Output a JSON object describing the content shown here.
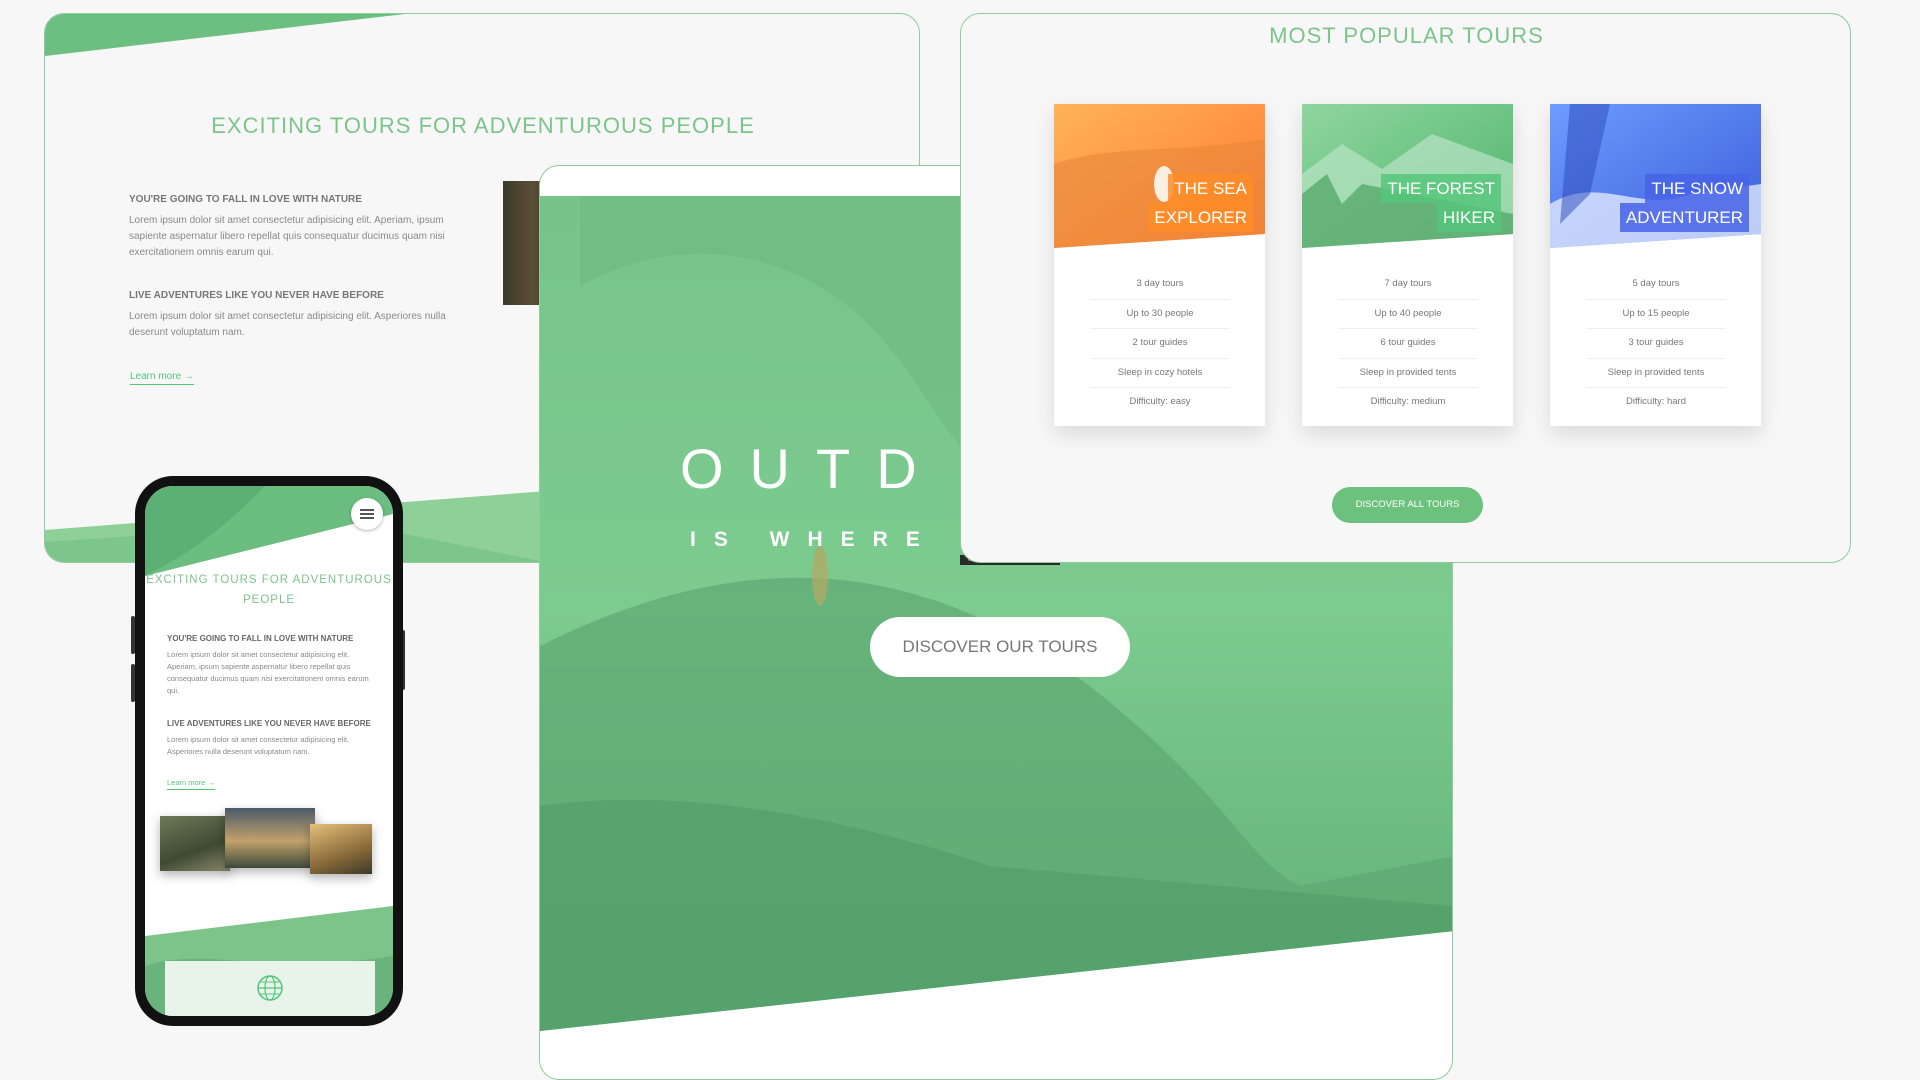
{
  "about": {
    "title": "EXCITING TOURS FOR ADVENTUROUS PEOPLE",
    "blocks": [
      {
        "heading": "YOU'RE GOING TO FALL IN LOVE WITH NATURE",
        "body": "Lorem ipsum dolor sit amet consectetur adipisicing elit. Aperiam, ipsum sapiente aspernatur libero repellat quis consequatur ducimus quam nisi exercitationem omnis earum qui."
      },
      {
        "heading": "LIVE ADVENTURES LIKE YOU NEVER HAVE BEFORE",
        "body": "Lorem ipsum dolor sit amet consectetur adipisicing elit. Asperiores nulla deserunt voluptatum nam."
      }
    ],
    "learn_more": "Learn more →"
  },
  "hero": {
    "heading": "OUTD",
    "subheading": "IS WHERE L",
    "cta": "DISCOVER OUR TOURS",
    "tooltip": "div.Lsfw. 596.4x84.4px"
  },
  "tours": {
    "title": "MOST POPULAR TOURS",
    "cta": "DISCOVER ALL TOURS",
    "cards": [
      {
        "name_line1": "THE SEA",
        "name_line2": "EXPLORER",
        "details": [
          "3 day tours",
          "Up to 30 people",
          "2 tour guides",
          "Sleep in cozy hotels",
          "Difficulty: easy"
        ]
      },
      {
        "name_line1": "THE FOREST",
        "name_line2": "HIKER",
        "details": [
          "7 day tours",
          "Up to 40 people",
          "6 tour guides",
          "Sleep in provided tents",
          "Difficulty: medium"
        ]
      },
      {
        "name_line1": "THE SNOW",
        "name_line2": "ADVENTURER",
        "details": [
          "5 day tours",
          "Up to 15 people",
          "3 tour guides",
          "Sleep in provided tents",
          "Difficulty: hard"
        ]
      }
    ]
  },
  "phone": {
    "title": "EXCITING TOURS FOR ADVENTUROUS PEOPLE",
    "blocks": [
      {
        "heading": "YOU'RE GOING TO FALL IN LOVE WITH NATURE",
        "body": "Lorem ipsum dolor sit amet consectetur adipisicing elit. Aperiam, ipsum sapiente aspernatur libero repellat quis consequatur ducimus quam nisi exercitationem omnis earum qui."
      },
      {
        "heading": "LIVE ADVENTURES LIKE YOU NEVER HAVE BEFORE",
        "body": "Lorem ipsum dolor sit amet consectetur adipisicing elit. Asperiores nulla deserunt voluptatum nam."
      }
    ],
    "learn_more": "Learn more →",
    "menu_icon": "hamburger-icon",
    "footer_icon": "globe-icon"
  },
  "colors": {
    "brand_green": "#55c57a",
    "title_green": "#7cc48a",
    "orange": "#ffb900",
    "blue": "#2998ff"
  }
}
